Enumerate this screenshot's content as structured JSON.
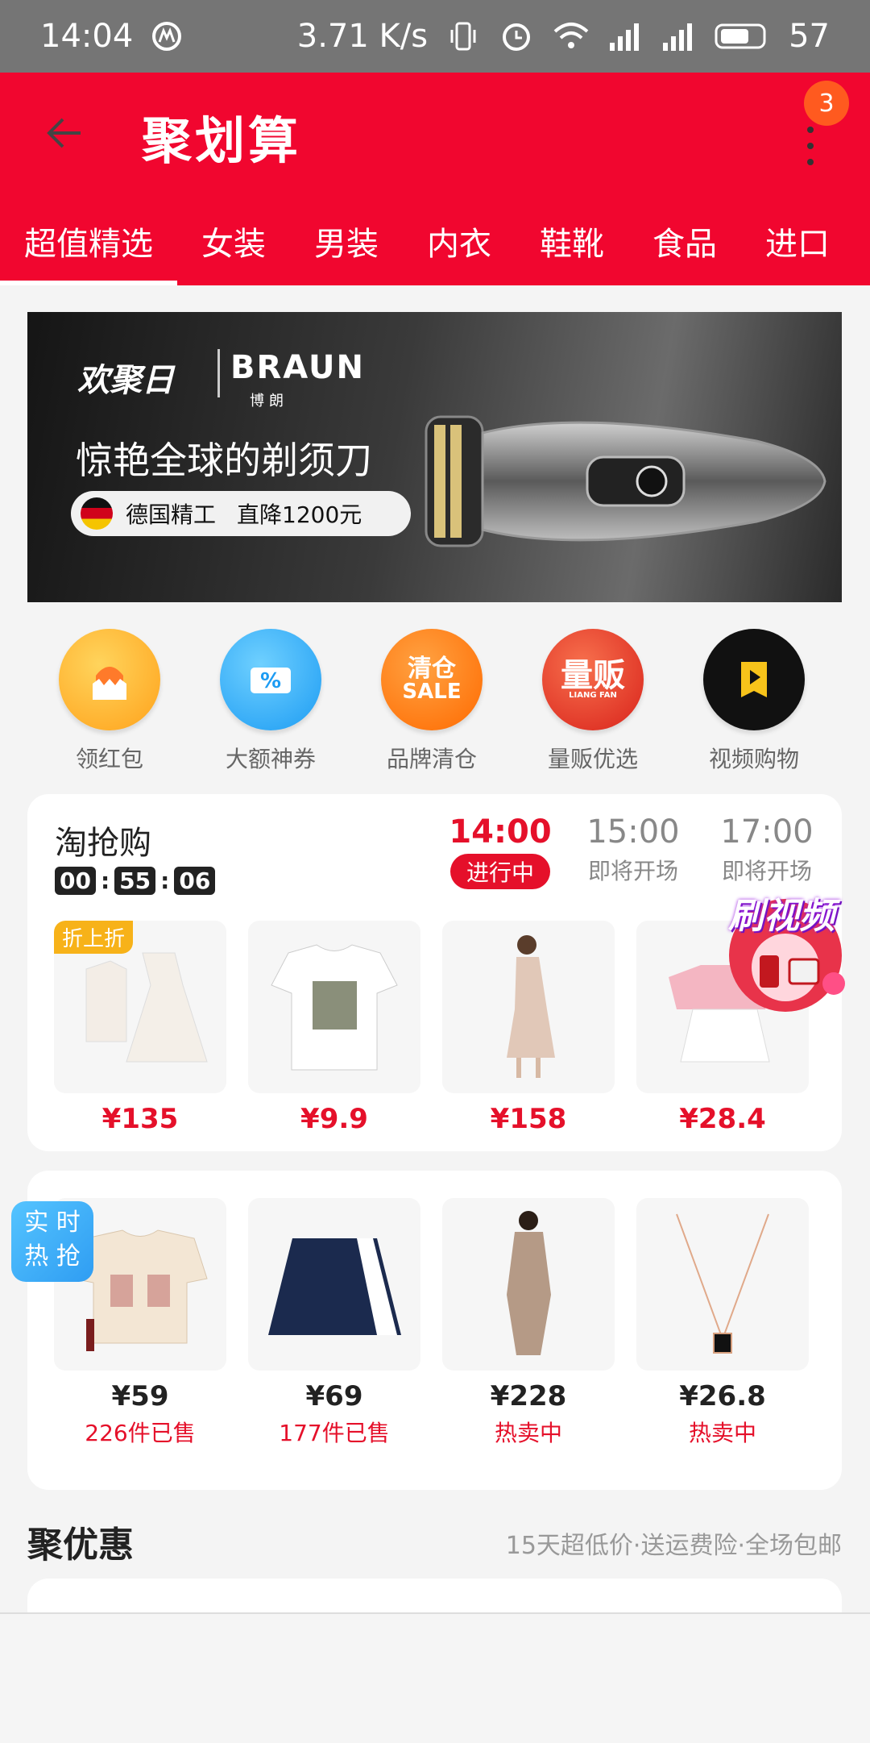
{
  "status_bar": {
    "time": "14:04",
    "speed": "3.71 K/s",
    "network1": "4G",
    "network2": "4G",
    "battery": "57"
  },
  "header": {
    "title": "聚划算",
    "notification_count": "3"
  },
  "tabs": [
    {
      "label": "超值精选"
    },
    {
      "label": "女装"
    },
    {
      "label": "男装"
    },
    {
      "label": "内衣"
    },
    {
      "label": "鞋靴"
    },
    {
      "label": "食品"
    },
    {
      "label": "进口"
    }
  ],
  "banner": {
    "brand": "欢聚日",
    "partner": "BRAUN",
    "partner_cn": "博朗",
    "headline": "惊艳全球的剃须刀",
    "pill_text": "德国精工",
    "pill_discount": "直降1200元"
  },
  "categories": [
    {
      "label": "领红包",
      "icon": "red-packet-icon",
      "color": "#ffb22c"
    },
    {
      "label": "大额神券",
      "icon": "coupon-icon",
      "color": "#36b6ff"
    },
    {
      "label": "品牌清仓",
      "icon": "clearance-sale-icon",
      "color": "#ff7a18",
      "icon_text_top": "清仓",
      "icon_text_bottom": "SALE"
    },
    {
      "label": "量贩优选",
      "icon": "bulk-buy-icon",
      "color": "#e83a2b",
      "icon_text_top": "量贩",
      "icon_text_bottom": "LIANG FAN"
    },
    {
      "label": "视频购物",
      "icon": "video-play-icon",
      "color": "#111111"
    }
  ],
  "flash_sale": {
    "title": "淘抢购",
    "countdown": [
      "00",
      "55",
      "06"
    ],
    "slots": [
      {
        "time": "14:00",
        "status": "进行中",
        "active": true
      },
      {
        "time": "15:00",
        "status": "即将开场",
        "active": false
      },
      {
        "time": "17:00",
        "status": "即将开场",
        "active": false
      }
    ],
    "products": [
      {
        "price": "¥135",
        "tag": "折上折",
        "icon": "jacket-dress-icon"
      },
      {
        "price": "¥9.9",
        "icon": "tshirt-icon"
      },
      {
        "price": "¥158",
        "icon": "model-dress-icon"
      },
      {
        "price": "¥28.4",
        "icon": "pink-top-skirt-icon"
      }
    ]
  },
  "video_promo": {
    "label": "刷视频"
  },
  "hot_sale": {
    "tag_line1": "实 时",
    "tag_line2": "热 抢",
    "products": [
      {
        "price": "¥59",
        "sub": "226件已售",
        "icon": "printed-shirt-icon"
      },
      {
        "price": "¥69",
        "sub": "177件已售",
        "icon": "pleated-skirt-icon"
      },
      {
        "price": "¥228",
        "sub": "热卖中",
        "icon": "trench-coat-icon"
      },
      {
        "price": "¥26.8",
        "sub": "热卖中",
        "icon": "necklace-icon"
      }
    ]
  },
  "ju_youhui": {
    "title": "聚优惠",
    "subtitle": "15天超低价·送运费险·全场包邮"
  }
}
